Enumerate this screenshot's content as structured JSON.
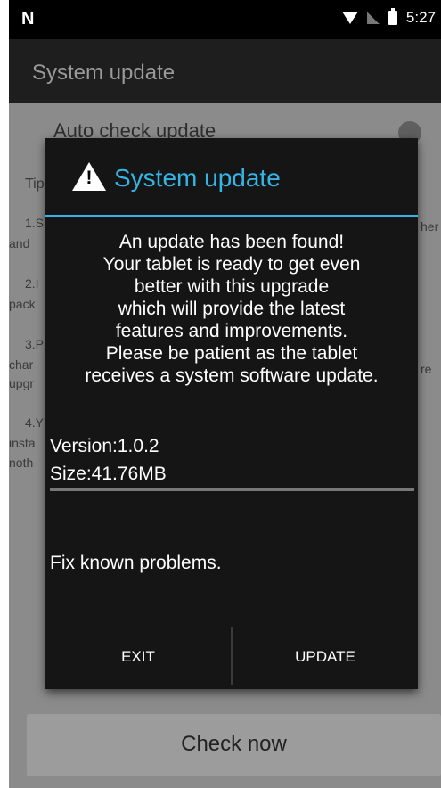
{
  "status_bar": {
    "left_icon": "N",
    "time": "5:27",
    "icons": [
      "wifi-icon",
      "no-signal-icon",
      "battery-icon"
    ]
  },
  "app_bar": {
    "title": "System update"
  },
  "settings": {
    "auto_check_label": "Auto check update",
    "tips": [
      {
        "text": "Tip"
      },
      {
        "text": "1.S"
      },
      {
        "text": "and"
      },
      {
        "text": "2.I"
      },
      {
        "text": "pack"
      },
      {
        "text": "3.P"
      },
      {
        "text": "char"
      },
      {
        "text": "upgr"
      },
      {
        "text": "4.Y"
      },
      {
        "text": "insta"
      },
      {
        "text": "noth"
      },
      {
        "text": "her"
      },
      {
        "text": "re"
      }
    ],
    "check_now_label": "Check now"
  },
  "dialog": {
    "title": "System update",
    "icon": "warning-icon",
    "message_lines": [
      "An update has been found!",
      "Your tablet is ready to get even",
      "better with this upgrade",
      "which will provide the latest",
      "features and improvements.",
      "Please be patient as the tablet",
      "receives a system software update."
    ],
    "version": "Version:1.0.2",
    "size": "Size:41.76MB",
    "notes": "Fix known problems.",
    "exit_label": "EXIT",
    "update_label": "UPDATE"
  },
  "colors": {
    "accent": "#34b5e5",
    "dialog_bg": "#151515",
    "scrim": "#8b8b8b"
  }
}
